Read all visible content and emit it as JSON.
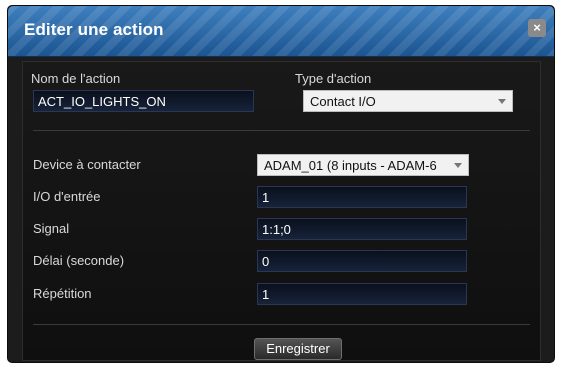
{
  "dialog": {
    "title": "Editer une action",
    "close_label": "×"
  },
  "form": {
    "action_name_label": "Nom de l'action",
    "action_name_value": "ACT_IO_LIGHTS_ON",
    "action_type_label": "Type d'action",
    "action_type_value": "Contact I/O",
    "device_label": "Device à contacter",
    "device_value": "ADAM_01 (8 inputs - ADAM-6",
    "io_label": "I/O d'entrée",
    "io_value": "1",
    "signal_label": "Signal",
    "signal_value": "1:1;0",
    "delay_label": "Délai (seconde)",
    "delay_value": "0",
    "repeat_label": "Répétition",
    "repeat_value": "1",
    "save_label": "Enregistrer"
  },
  "colors": {
    "titlebar": "#2a69a8",
    "panel": "#151515",
    "input_bg": "#101829"
  }
}
